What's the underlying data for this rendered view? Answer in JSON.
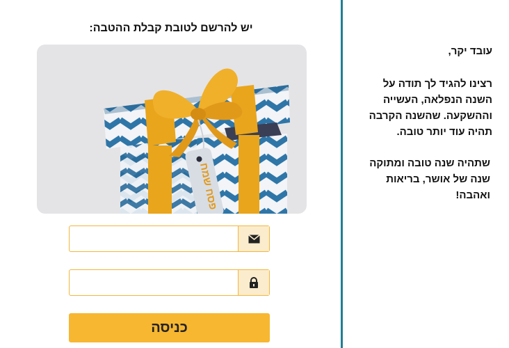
{
  "form": {
    "title": "יש להרשם לטובת קבלת ההטבה:",
    "email": {
      "value": "",
      "placeholder": "",
      "icon": "envelope-icon"
    },
    "password": {
      "value": "",
      "placeholder": "",
      "icon": "lock-icon"
    },
    "login_label": "כניסה"
  },
  "gift_image": {
    "tag_text": "פסח שמח"
  },
  "message": {
    "greeting": "עובד יקר,",
    "paragraph1": "רצינו להגיד לך תודה על השנה הנפלאה, העשייה וההשקעה. שהשנה הקרבה תהיה עוד יותר טובה.",
    "paragraph2": "שתהיה שנה טובה ומתוקה שנה של אושר, בריאות ואהבה!"
  },
  "colors": {
    "accent": "#f7b731",
    "addon_bg": "#fbeccd",
    "divider": "#1f7f95",
    "gift_blue": "#2f76a8",
    "ribbon": "#e9a51c"
  }
}
